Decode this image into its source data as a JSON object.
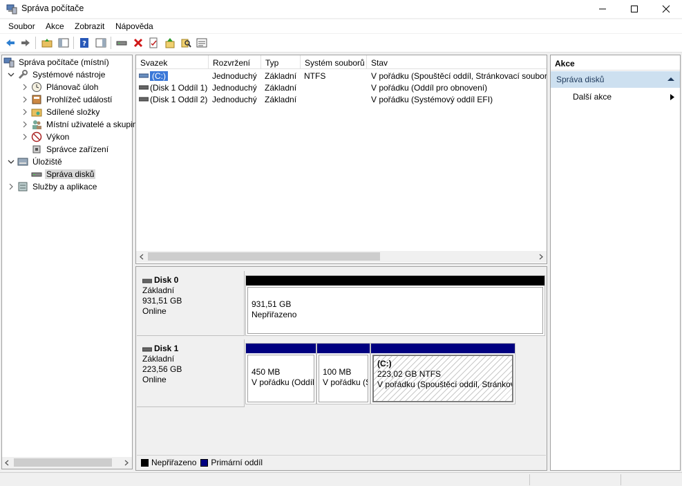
{
  "window": {
    "title": "Správa počítače"
  },
  "menu": [
    "Soubor",
    "Akce",
    "Zobrazit",
    "Nápověda"
  ],
  "tree": {
    "items": [
      {
        "label": "Správa počítače (místní)",
        "icon": "computer-icon"
      },
      {
        "label": "Systémové nástroje",
        "icon": "tools-icon"
      },
      {
        "label": "Plánovač úloh",
        "icon": "clock-icon"
      },
      {
        "label": "Prohlížeč událostí",
        "icon": "event-viewer-icon"
      },
      {
        "label": "Sdílené složky",
        "icon": "shared-folder-icon"
      },
      {
        "label": "Místní uživatelé a skupiny",
        "icon": "users-icon"
      },
      {
        "label": "Výkon",
        "icon": "performance-icon"
      },
      {
        "label": "Správce zařízení",
        "icon": "device-manager-icon"
      },
      {
        "label": "Úložiště",
        "icon": "storage-icon"
      },
      {
        "label": "Správa disků",
        "icon": "disk-icon"
      },
      {
        "label": "Služby a aplikace",
        "icon": "services-icon"
      }
    ]
  },
  "list": {
    "columns": [
      "Svazek",
      "Rozvržení",
      "Typ",
      "Systém souborů",
      "Stav"
    ],
    "rows": [
      {
        "volume": "(C:)",
        "layout": "Jednoduchý",
        "type": "Základní",
        "fs": "NTFS",
        "status": "V pořádku (Spouštěcí oddíl, Stránkovací soubor, Výpis"
      },
      {
        "volume": "(Disk 1 Oddíl 1)",
        "layout": "Jednoduchý",
        "type": "Základní",
        "fs": "",
        "status": "V pořádku (Oddíl pro obnovení)"
      },
      {
        "volume": "(Disk 1 Oddíl 2)",
        "layout": "Jednoduchý",
        "type": "Základní",
        "fs": "",
        "status": "V pořádku (Systémový oddíl EFI)"
      }
    ]
  },
  "disks": [
    {
      "name": "Disk 0",
      "kind": "Základní",
      "size": "931,51 GB",
      "state": "Online",
      "partitions": [
        {
          "name": "",
          "size": "931,51 GB",
          "status": "Nepřiřazeno"
        }
      ]
    },
    {
      "name": "Disk 1",
      "kind": "Základní",
      "size": "223,56 GB",
      "state": "Online",
      "partitions": [
        {
          "name": "",
          "size": "450 MB",
          "status": "V pořádku (Oddíl pro obnovení)"
        },
        {
          "name": "",
          "size": "100 MB",
          "status": "V pořádku (Systémový oddíl EFI)"
        },
        {
          "name": "(C:)",
          "size": "223,02 GB NTFS",
          "status": "V pořádku (Spouštěcí oddíl, Stránkovací soubor, Výpis"
        }
      ]
    }
  ],
  "legend": [
    {
      "label": "Nepřiřazeno",
      "color": "#000000"
    },
    {
      "label": "Primární oddíl",
      "color": "#000080"
    }
  ],
  "actions": {
    "header": "Akce",
    "group": "Správa disků",
    "more": "Další akce"
  },
  "colors": {
    "unallocated": "#000000",
    "primary": "#000080",
    "selection": "#cde0f0"
  }
}
